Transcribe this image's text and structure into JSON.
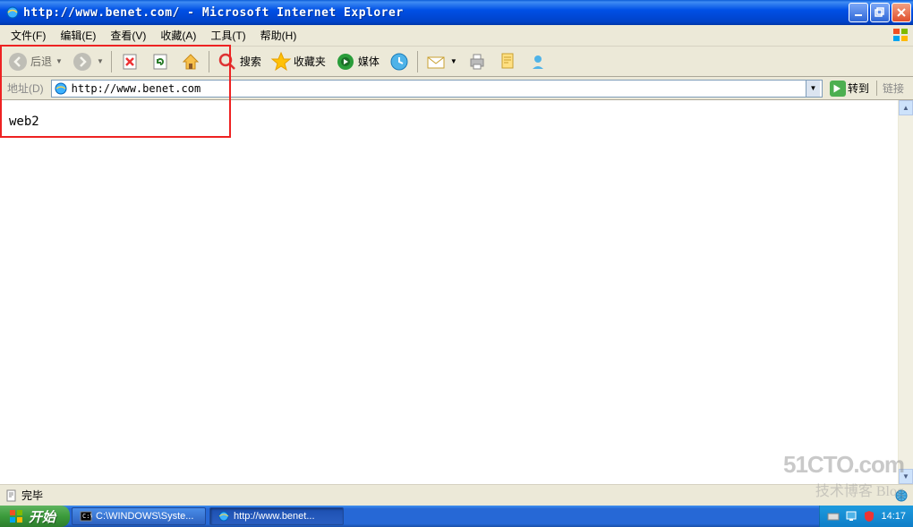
{
  "window": {
    "title": "http://www.benet.com/ - Microsoft Internet Explorer"
  },
  "menu": {
    "file": "文件(F)",
    "edit": "编辑(E)",
    "view": "查看(V)",
    "favorites": "收藏(A)",
    "tools": "工具(T)",
    "help": "帮助(H)"
  },
  "toolbar": {
    "back": "后退",
    "search": "搜索",
    "favorites": "收藏夹",
    "media": "媒体"
  },
  "address": {
    "label": "地址(D)",
    "url": "http://www.benet.com",
    "go": "转到",
    "links": "链接"
  },
  "page": {
    "body": "web2"
  },
  "status": {
    "text": "完毕"
  },
  "taskbar": {
    "start": "开始",
    "item1": "C:\\WINDOWS\\Syste...",
    "item2": "http://www.benet...",
    "time": "14:17"
  },
  "watermark": {
    "line1": "51CTO.com",
    "line2": "技术博客  Blog"
  }
}
